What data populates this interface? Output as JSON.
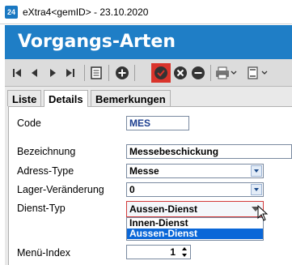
{
  "window": {
    "app_icon_text": "24",
    "title": "eXtra4<gemID> - 23.10.2020"
  },
  "header": {
    "title": "Vorgangs-Arten",
    "color": "#1f7ec6"
  },
  "toolbar": {
    "buttons": [
      "first-icon",
      "previous-icon",
      "next-icon",
      "last-icon",
      "list-icon",
      "add-icon",
      "confirm-icon",
      "cancel-icon",
      "remove-icon",
      "print-icon",
      "form-icon"
    ],
    "active_color": "#d9342b"
  },
  "tabs": [
    {
      "label": "Liste",
      "active": false
    },
    {
      "label": "Details",
      "active": true
    },
    {
      "label": "Bemerkungen",
      "active": false
    }
  ],
  "form": {
    "code": {
      "label": "Code",
      "value": "MES"
    },
    "bezeichnung": {
      "label": "Bezeichnung",
      "value": "Messebeschickung"
    },
    "adress_type": {
      "label": "Adress-Type",
      "value": "Messe"
    },
    "lager": {
      "label": "Lager-Veränderung",
      "value": "0"
    },
    "dienst_typ": {
      "label": "Dienst-Typ",
      "value": "Aussen-Dienst",
      "options": [
        "Innen-Dienst",
        "Aussen-Dienst"
      ],
      "selected_index": 1
    },
    "menu_index": {
      "label": "Menü-Index",
      "value": "1"
    }
  }
}
